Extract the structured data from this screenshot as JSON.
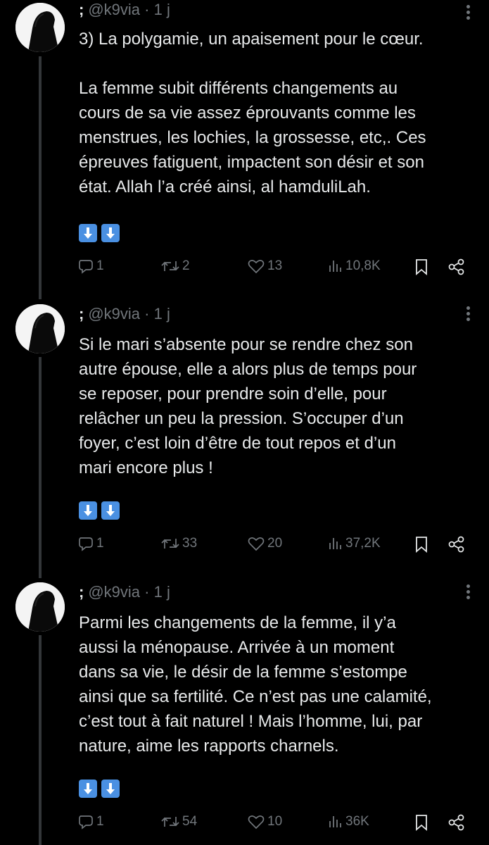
{
  "tweets": [
    {
      "author": {
        "name": ";",
        "handle": "@k9via",
        "time": "1 j"
      },
      "text": "3) La polygamie, un apaisement pour le cœur.\n\nLa femme subit différents changements au\ncours de sa vie assez éprouvants comme les\nmenstrues, les lochies, la grossesse, etc,. Ces\népreuves fatiguent, impactent son désir et son\nétat. Allah l’a créé ainsi, al hamduliLah.",
      "stats": {
        "replies": "1",
        "retweets": "2",
        "likes": "13",
        "views": "10,8K"
      }
    },
    {
      "author": {
        "name": ";",
        "handle": "@k9via",
        "time": "1 j"
      },
      "text": "Si le mari s’absente pour se rendre chez son\nautre épouse, elle a alors plus de temps pour\nse reposer, pour prendre soin d’elle, pour\nrelâcher un peu la pression. S’occuper d’un\nfoyer, c’est loin d’être de tout repos et d’un\nmari encore plus !",
      "stats": {
        "replies": "1",
        "retweets": "33",
        "likes": "20",
        "views": "37,2K"
      }
    },
    {
      "author": {
        "name": ";",
        "handle": "@k9via",
        "time": "1 j"
      },
      "text": "Parmi les changements de la femme, il y’a\naussi la ménopause. Arrivée à un moment\ndans sa vie, le désir de la femme s’estompe\nainsi que sa fertilité. Ce n’est pas une calamité,\nc’est tout à fait naturel ! Mais l’homme, lui, par\nnature, aime les rapports charnels.",
      "stats": {
        "replies": "1",
        "retweets": "54",
        "likes": "10",
        "views": "36K"
      }
    }
  ],
  "icons": {
    "more": "more-vertical-icon",
    "reply": "reply-icon",
    "retweet": "retweet-icon",
    "like": "heart-icon",
    "views": "views-bar-chart-icon",
    "bookmark": "bookmark-icon",
    "share": "share-icon",
    "arrow": "down-arrow-emoji"
  },
  "colors": {
    "background": "#000000",
    "text": "#e7e9ea",
    "muted": "#71767b",
    "thread_line": "#333639",
    "arrow_emoji": "#4a90e2"
  }
}
